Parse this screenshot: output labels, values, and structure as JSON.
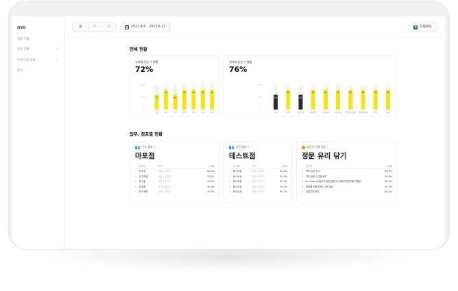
{
  "sidebar": {
    "items": [
      {
        "label": "리포트",
        "active": true,
        "chevron": false
      },
      {
        "label": "점포 현황",
        "active": false,
        "chevron": false
      },
      {
        "label": "업무 현황",
        "active": false,
        "chevron": true
      },
      {
        "label": "전달사항 현황",
        "active": false,
        "chevron": true
      },
      {
        "label": "랭커",
        "active": false,
        "chevron": false
      }
    ]
  },
  "topbar": {
    "period_tabs": [
      "일",
      "주",
      "월"
    ],
    "active_tab": "일",
    "date_range": "2023.4.6 - 2023.4.12",
    "download_label": "다운로드"
  },
  "overview": {
    "title": "전체 현황",
    "left": {
      "label": "일자별 평균 수행률",
      "value": "72%"
    },
    "right": {
      "label": "점포별 평균 수행률",
      "value": "76%"
    }
  },
  "chart_data": [
    {
      "type": "bar",
      "title": "일자별 평균 수행률",
      "categories": [
        "월요",
        "화요",
        "수요",
        "목요",
        "금요",
        "토요",
        "일요"
      ],
      "values": [
        60,
        80,
        60,
        80,
        80,
        80,
        80
      ],
      "bar_labels": [
        "60",
        "80",
        "60",
        "80",
        "80",
        "80",
        "80"
      ],
      "y_ticks": [
        "100%",
        "50%",
        "0%"
      ],
      "ylim": [
        0,
        100
      ],
      "colors": {
        "bar": "#f7e01c",
        "track": "#f2f2f2"
      }
    },
    {
      "type": "bar",
      "title": "점포별 평균 수행률",
      "categories": [
        "마포",
        "서원",
        "테스트점",
        "마포본부",
        "고모리점",
        "우성그룹",
        "우성스토어점",
        "본사평가점",
        "평균",
        "로보"
      ],
      "values": [
        60,
        80,
        60,
        80,
        80,
        80,
        80,
        80,
        80,
        80
      ],
      "bar_labels": [
        "60",
        "80",
        "60",
        "80",
        "80",
        "80",
        "80",
        "80",
        "80",
        "80"
      ],
      "dark_bars": [
        0,
        2
      ],
      "y_ticks": [
        "100%",
        "50%",
        "0%"
      ],
      "ylim": [
        0,
        100
      ],
      "colors": {
        "bar": "#f7e01c",
        "dark": "#2b2b2b",
        "track": "#f2f2f2"
      }
    }
  ],
  "tasks": {
    "title": "업무, 점포별 현황",
    "cards": [
      {
        "tag": "우수 점포 〉",
        "icon": "shops-icon",
        "name": "마포점",
        "head": [
          "점포명",
          "항목",
          "수행률"
        ],
        "rows": [
          {
            "no": "1",
            "name": "마포점",
            "mid": "서울시 마포구",
            "rate": "80.2%"
          },
          {
            "no": "2",
            "name": "당가체점",
            "mid": "서울시 성북구",
            "rate": "70.2%"
          },
          {
            "no": "3",
            "name": "판수점",
            "mid": "인천시 연수구",
            "rate": "60.2%"
          },
          {
            "no": "4",
            "name": "분점점",
            "mid": "경기도 화성시",
            "rate": "50.4%"
          },
          {
            "no": "5",
            "name": "당가체점",
            "mid": "서울시 성북구",
            "rate": "40.3%"
          }
        ]
      },
      {
        "tag": "부진 점포 〉",
        "icon": "shops-icon",
        "name": "테스트점",
        "head": [
          "점포명",
          "항목",
          "수행률"
        ],
        "rows": [
          {
            "no": "1",
            "name": "테스트점",
            "mid": "서울시 마포구",
            "rate": "40.3%"
          },
          {
            "no": "2",
            "name": "테스트점",
            "mid": "서울시 마포구",
            "rate": "50.4%"
          },
          {
            "no": "3",
            "name": "테스트점",
            "mid": "서울시 마포구",
            "rate": "60.3%"
          },
          {
            "no": "4",
            "name": "테스트점",
            "mid": "서울시 마포구",
            "rate": "70.2%"
          },
          {
            "no": "5",
            "name": "테스트점",
            "mid": "서울시 마포구",
            "rate": "80.2%"
          }
        ]
      },
      {
        "tag": "부진한 수행 업무 〉",
        "icon": "alert-icon",
        "name": "정문 유리 닦기",
        "head": [
          "업무명",
          "수행률"
        ],
        "rows": [
          {
            "no": "1",
            "name": "정문 유리 닦기",
            "rate": "40.3%"
          },
          {
            "no": "2",
            "name": "선반 정리 / 진열 배치",
            "rate": "50.4%"
          },
          {
            "no": "3",
            "name": "Re-Open(오픈후가 점검진열) 및 매대(진열대)를 진행상",
            "rate": "60.3%"
          },
          {
            "no": "4",
            "name": "매년에 보충(보충) 가득 확인",
            "rate": "70.2%"
          },
          {
            "no": "5",
            "name": "유통기한 확인",
            "rate": "80.2%"
          }
        ]
      }
    ]
  }
}
